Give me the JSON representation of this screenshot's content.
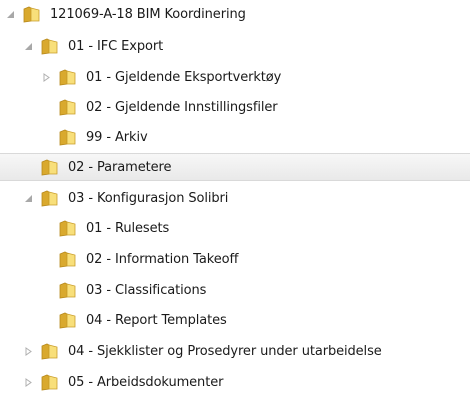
{
  "tree": {
    "items": [
      {
        "label": "121069-A-18 BIM Koordinering",
        "state": "expanded",
        "selected": false
      },
      {
        "label": "01 - IFC Export",
        "state": "expanded",
        "selected": false
      },
      {
        "label": "01 - Gjeldende Eksportverktøy",
        "state": "collapsed",
        "selected": false
      },
      {
        "label": "02 - Gjeldende Innstillingsfiler",
        "state": "none",
        "selected": false
      },
      {
        "label": "99 - Arkiv",
        "state": "none",
        "selected": false
      },
      {
        "label": "02 - Parametere",
        "state": "none",
        "selected": true
      },
      {
        "label": "03 - Konfigurasjon Solibri",
        "state": "expanded",
        "selected": false
      },
      {
        "label": "01 - Rulesets",
        "state": "none",
        "selected": false
      },
      {
        "label": "02 - Information Takeoff",
        "state": "none",
        "selected": false
      },
      {
        "label": "03 - Classifications",
        "state": "none",
        "selected": false
      },
      {
        "label": "04 - Report Templates",
        "state": "none",
        "selected": false
      },
      {
        "label": "04 - Sjekklister og Prosedyrer under utarbeidelse",
        "state": "collapsed",
        "selected": false
      },
      {
        "label": "05 - Arbeidsdokumenter",
        "state": "collapsed",
        "selected": false
      }
    ]
  },
  "icons": {
    "folder": "folder-icon",
    "expanded": "expanded-arrow-icon",
    "collapsed": "collapsed-arrow-icon"
  },
  "colors": {
    "folder_light": "#f8df7a",
    "folder_dark": "#d9a92e",
    "folder_edge": "#b88a1c",
    "selection": "#e9e9e9",
    "arrow": "#9a9a9a"
  }
}
